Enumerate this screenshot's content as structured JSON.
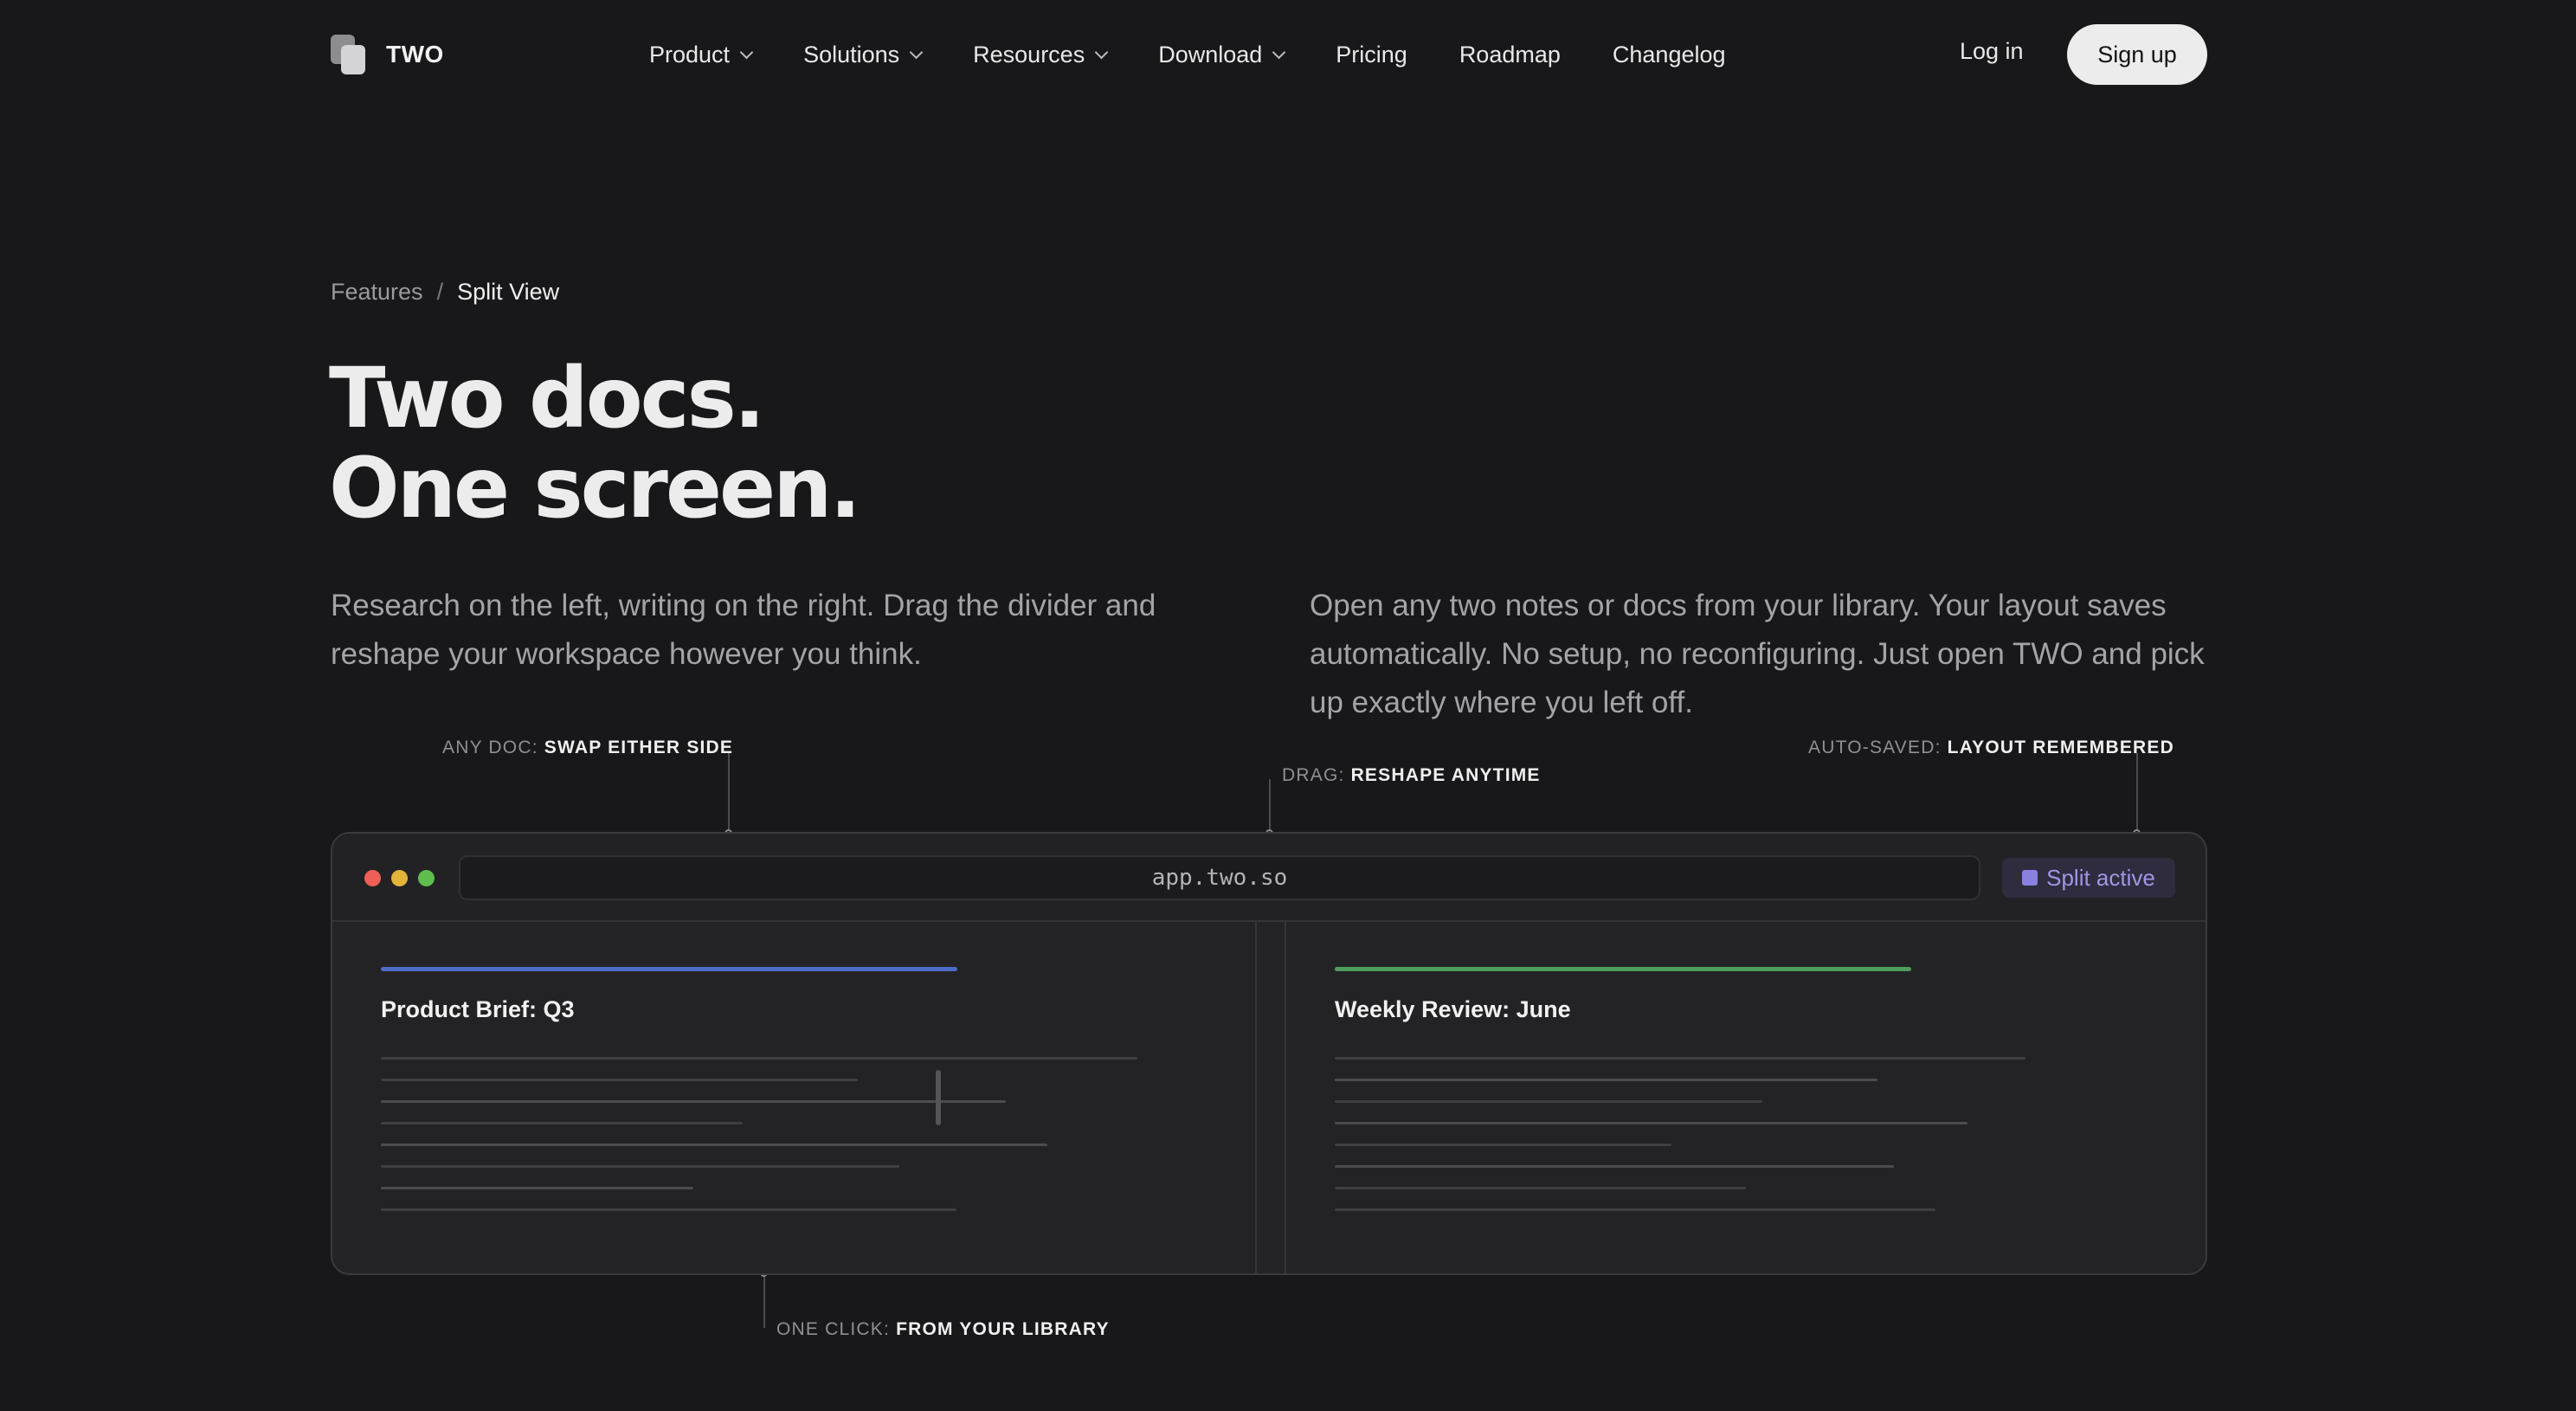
{
  "nav": {
    "logo_text": "TWO",
    "menu": [
      {
        "label": "Product",
        "has_dropdown": true
      },
      {
        "label": "Solutions",
        "has_dropdown": true
      },
      {
        "label": "Resources",
        "has_dropdown": true
      },
      {
        "label": "Download",
        "has_dropdown": true
      },
      {
        "label": "Pricing",
        "has_dropdown": false
      },
      {
        "label": "Roadmap",
        "has_dropdown": false
      },
      {
        "label": "Changelog",
        "has_dropdown": false
      }
    ],
    "login_label": "Log in",
    "signup_label": "Sign up"
  },
  "breadcrumb": {
    "parent": "Features",
    "separator": "/",
    "current": "Split View"
  },
  "hero": {
    "headline_line1": "Two docs.",
    "headline_line2": "One screen.",
    "intro_left": "Research on the left, writing on the right. Drag the divider and reshape your workspace however you think.",
    "intro_right": "Open any two notes or docs from your library. Your layout saves automatically. No setup, no reconfiguring. Just open TWO and pick up exactly where you left off."
  },
  "callouts": {
    "any_doc": {
      "key": "ANY DOC:",
      "value": "SWAP EITHER SIDE"
    },
    "drag": {
      "key": "DRAG:",
      "value": "RESHAPE ANYTIME"
    },
    "auto_saved": {
      "key": "AUTO-SAVED:",
      "value": "LAYOUT REMEMBERED"
    },
    "one_click": {
      "key": "ONE CLICK:",
      "value": "FROM YOUR LIBRARY"
    }
  },
  "app": {
    "url": "app.two.so",
    "badge_label": "Split active",
    "left_doc": {
      "title": "Product Brief: Q3",
      "accent_color": "#4f6cc4"
    },
    "right_doc": {
      "title": "Weekly Review: June",
      "accent_color": "#4e9d5c"
    }
  },
  "colors": {
    "background": "#18181a",
    "traffic_red": "#ed5f57",
    "traffic_yellow": "#e4b43a",
    "traffic_green": "#5fbd4e",
    "badge_accent": "#8a80e0"
  }
}
